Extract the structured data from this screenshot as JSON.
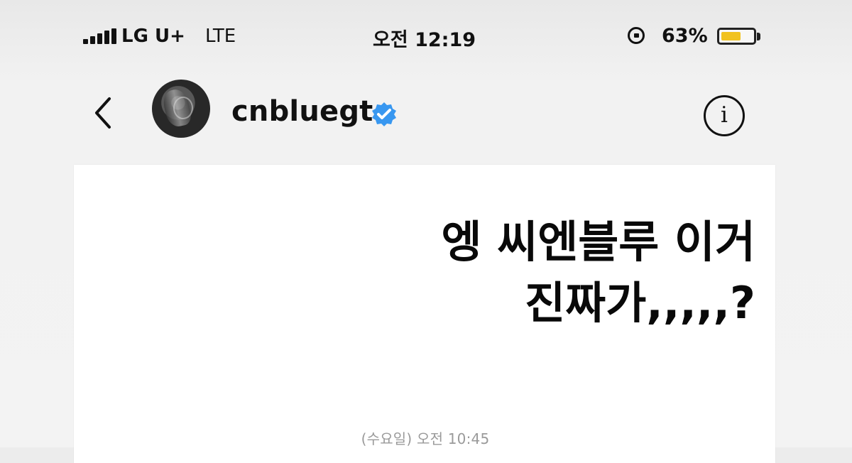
{
  "status_bar": {
    "carrier": "LG U+",
    "network": "LTE",
    "time": "오전 12:19",
    "battery_percent": "63%",
    "battery_level": 0.63,
    "icons": [
      "signal-icon",
      "rotation-lock-icon",
      "battery-icon"
    ]
  },
  "header": {
    "username": "cnbluegt",
    "verified_icon": "verified-icon",
    "back_icon": "back-icon",
    "info_label": "i",
    "colors": {
      "verified_blue": "#3897f0",
      "text": "#111111"
    }
  },
  "message": {
    "text": "엥 씨엔블루 이거\n진짜가,,,,,?",
    "timestamp": "(수요일) 오전 10:45"
  }
}
